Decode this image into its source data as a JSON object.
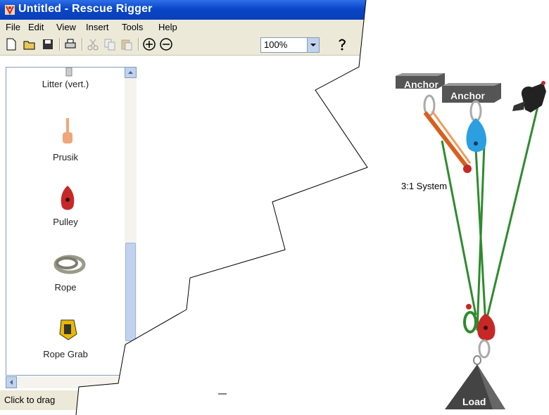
{
  "window": {
    "title": "Untitled - Rescue Rigger"
  },
  "menu": [
    "File",
    "Edit",
    "View",
    "Insert",
    "Tools",
    "Help"
  ],
  "toolbar": {
    "icons": [
      "new-icon",
      "open-icon",
      "save-icon",
      "print-icon",
      "cut-icon",
      "copy-icon",
      "paste-icon",
      "zoom-in-icon",
      "zoom-out-icon",
      "help-icon"
    ],
    "zoom_value": "100%"
  },
  "palette": {
    "items": [
      {
        "label": "Litter (vert.)",
        "icon": "litter-icon"
      },
      {
        "label": "Prusik",
        "icon": "prusik-icon"
      },
      {
        "label": "Pulley",
        "icon": "pulley-icon"
      },
      {
        "label": "Rope",
        "icon": "rope-icon"
      },
      {
        "label": "Rope Grab",
        "icon": "rope-grab-icon"
      }
    ]
  },
  "status": {
    "text": "Click to drag"
  },
  "diagram": {
    "anchor_1": "Anchor",
    "anchor_2": "Anchor",
    "system_label": "3:1 System",
    "load_label": "Load",
    "colors": {
      "rope": "#2e8b2e",
      "pulley": "#c62828",
      "blue_pulley": "#2b9fe0",
      "prusik": "#d8601f"
    }
  }
}
